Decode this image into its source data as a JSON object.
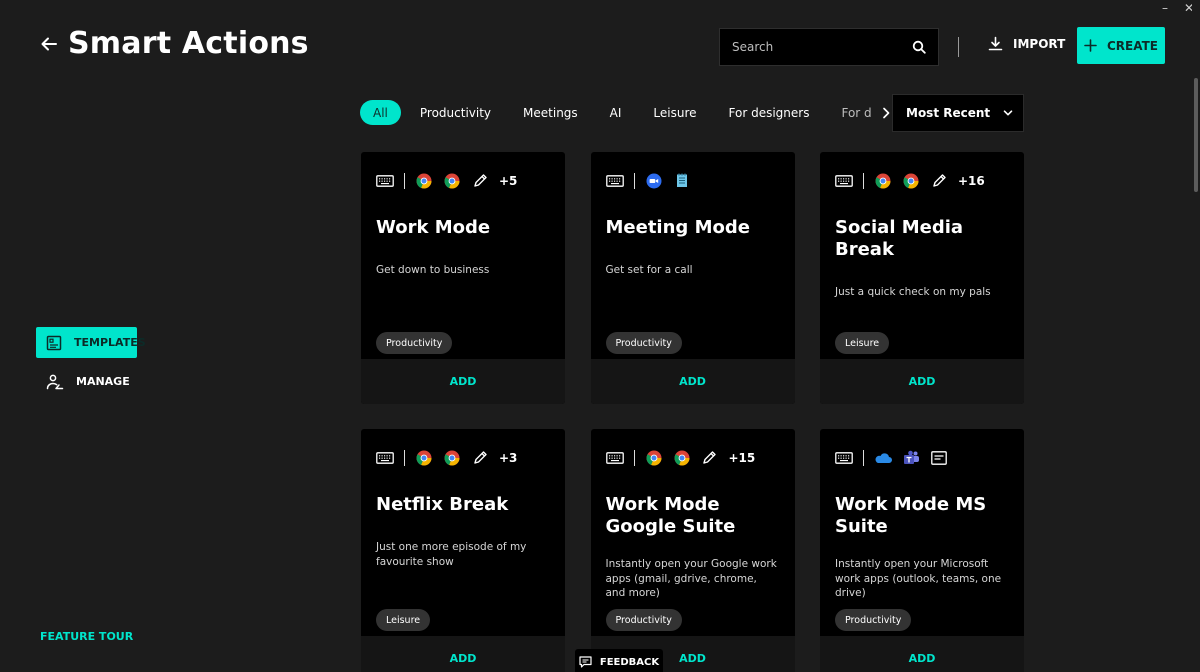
{
  "window": {
    "minimize_glyph": "–",
    "close_glyph": "✕"
  },
  "header": {
    "title": "Smart Actions",
    "search_placeholder": "Search",
    "import_label": "IMPORT",
    "create_label": "CREATE"
  },
  "filters": {
    "items": [
      "All",
      "Productivity",
      "Meetings",
      "AI",
      "Leisure",
      "For designers",
      "For d"
    ],
    "active": "All"
  },
  "sort": {
    "selected": "Most Recent"
  },
  "sidebar": {
    "templates_label": "TEMPLATES",
    "manage_label": "MANAGE",
    "feature_tour_label": "FEATURE TOUR"
  },
  "cards": [
    {
      "title": "Work Mode",
      "description": "Get down to business",
      "tag": "Productivity",
      "more": "+5",
      "add_label": "ADD"
    },
    {
      "title": "Meeting Mode",
      "description": "Get set for a call",
      "tag": "Productivity",
      "more": "",
      "add_label": "ADD"
    },
    {
      "title": "Social Media Break",
      "description": "Just a quick check on my pals",
      "tag": "Leisure",
      "more": "+16",
      "add_label": "ADD"
    },
    {
      "title": "Netflix Break",
      "description": "Just one more episode of my favourite show",
      "tag": "Leisure",
      "more": "+3",
      "add_label": "ADD"
    },
    {
      "title": "Work Mode Google Suite",
      "description": "Instantly open your Google work apps (gmail, gdrive, chrome, and more)",
      "tag": "Productivity",
      "more": "+15",
      "add_label": "ADD"
    },
    {
      "title": "Work Mode MS Suite",
      "description": "Instantly open your Microsoft work apps (outlook, teams, one drive)",
      "tag": "Productivity",
      "more": "",
      "add_label": "ADD"
    }
  ],
  "feedback": {
    "label": "FEEDBACK"
  },
  "colors": {
    "accent": "#00e5cc",
    "background": "#1c1c1c",
    "card": "#000000",
    "card_footer": "#151515",
    "tag": "#333333"
  },
  "icons": [
    "back-arrow-icon",
    "search-icon",
    "download-icon",
    "plus-icon",
    "chevron-right-icon",
    "chevron-down-icon",
    "template-icon",
    "manage-icon",
    "keyboard-icon",
    "chrome-icon",
    "pencil-icon",
    "zoom-icon",
    "notepad-icon",
    "onedrive-icon",
    "teams-icon",
    "window-icon",
    "feedback-icon"
  ]
}
